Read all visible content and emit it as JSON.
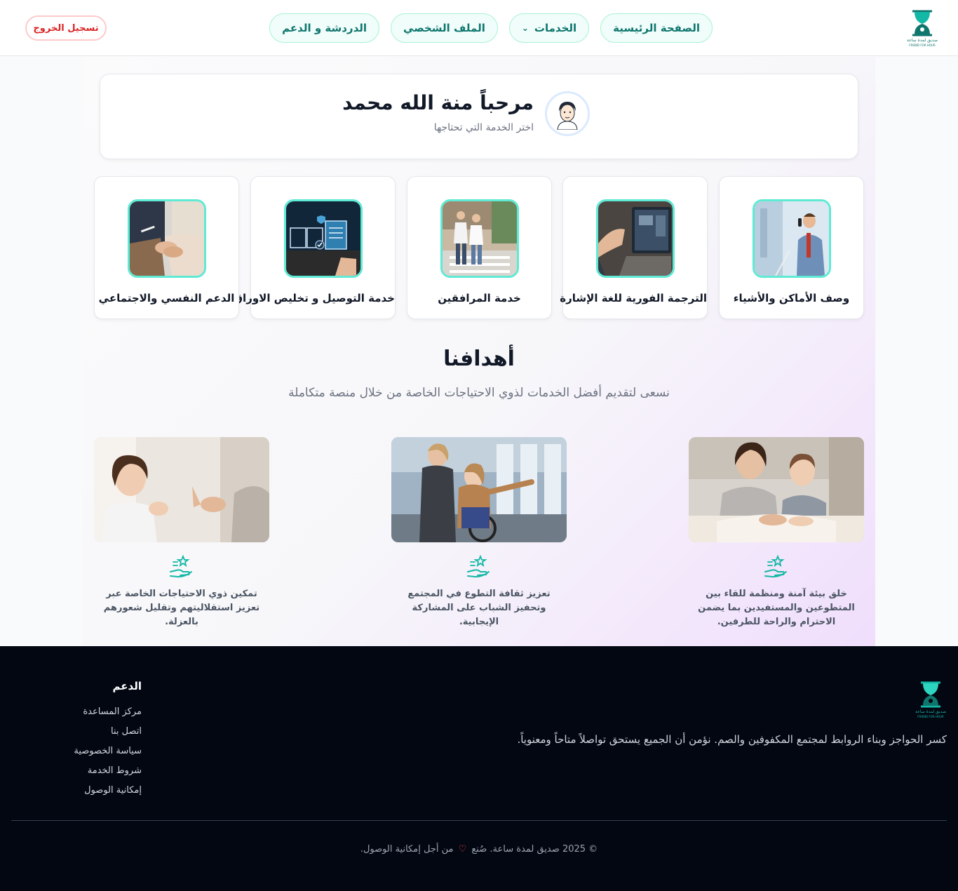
{
  "header": {
    "nav": [
      {
        "label": "الصفحة الرئيسية",
        "name": "nav-home"
      },
      {
        "label": "الخدمات",
        "name": "nav-services"
      },
      {
        "label": "الملف الشخصي",
        "name": "nav-profile"
      },
      {
        "label": "الدردشة و الدعم",
        "name": "nav-chat-support"
      }
    ],
    "logout_label": "تسجيل الخروج",
    "logo_text": "صديق لمدة ساعة",
    "logo_subtext": "FRIEND FOR HOUR"
  },
  "welcome": {
    "title": "مرحباً منة الله محمد",
    "subtitle": "اختر الخدمة التي تحتاجها"
  },
  "services": [
    {
      "label": "وصف الأماكن والأشياء",
      "icon": "voice-describe-photo"
    },
    {
      "label": "الترجمة الفورية للغة الإشارة",
      "icon": "sign-language-laptop-photo"
    },
    {
      "label": "خدمة المرافقين",
      "icon": "companions-walking-photo"
    },
    {
      "label": "خدمة التوصيل و تخليص الاوراق",
      "icon": "documents-delivery-photo"
    },
    {
      "label": "الدعم النفسي والاجتماعي",
      "icon": "psych-support-photo"
    }
  ],
  "goals": {
    "title": "أهدافنا",
    "subtitle": "نسعى لتقديم أفضل الخدمات لذوي الاحتياجات الخاصة من خلال منصة متكاملة",
    "items": [
      {
        "text": "خلق بيئة آمنة ومنظمة للقاء بين المتطوعين والمستفيدين بما يضمن الاحترام والراحة للطرفين.",
        "icon": "hand-stars-icon"
      },
      {
        "text": "تعزيز ثقافة التطوع في المجتمع وتحفيز الشباب على المشاركة الإيجابية.",
        "icon": "hand-stars-icon"
      },
      {
        "text": "تمكين ذوي الاحتياجات الخاصة عبر تعزيز استقلاليتهم وتقليل شعورهم بالعزلة.",
        "icon": "hand-stars-icon"
      }
    ]
  },
  "footer": {
    "tagline": "كسر الحواجز وبناء الروابط لمجتمع المكفوفين والصم. نؤمن أن الجميع يستحق تواصلاً متاحاً ومعنوياً.",
    "support_title": "الدعم",
    "links": [
      "مركز المساعدة",
      "اتصل بنا",
      "سياسة الخصوصية",
      "شروط الخدمة",
      "إمكانية الوصول"
    ],
    "copyright_before": "© 2025 صديق لمدة ساعة. صُنع",
    "copyright_after": "من أجل إمكانية الوصول."
  },
  "colors": {
    "accent": "#0f766e",
    "accent_border": "#a7f3d0",
    "teal_frame": "#5eead4",
    "danger": "#dc2626",
    "footer_bg": "#030712"
  }
}
